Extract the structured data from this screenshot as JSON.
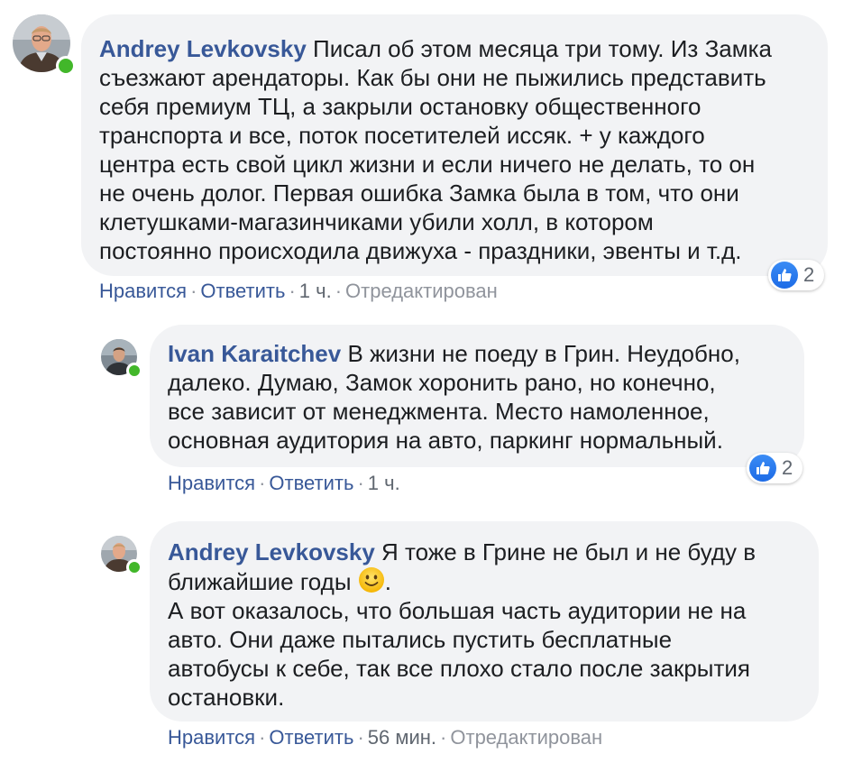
{
  "comments": [
    {
      "author": "Andrey Levkovsky",
      "lines": [
        "Писал об этом месяца три тому. Из Замка",
        "съезжают арендаторы. Как бы они не пыжились представить",
        "себя премиум ТЦ, а закрыли остановку общественного",
        "транспорта и все, поток посетителей иссяк. + у каждого",
        "центра есть свой цикл жизни и если ничего не делать, то он",
        "не очень долог. Первая ошибка Замка была в том, что они",
        "клетушками-магазинчиками убили холл, в котором",
        "постоянно происходила движуха - праздники, эвенты и т.д."
      ],
      "actions": {
        "like": "Нравится",
        "reply": "Ответить",
        "time": "1 ч.",
        "edited": "Отредактирован"
      },
      "reaction_count": "2"
    },
    {
      "author": "Ivan Karaitchev",
      "lines": [
        "В жизни не поеду в Грин. Неудобно,",
        "далеко. Думаю, Замок хоронить рано, но конечно,",
        "все зависит от менеджмента. Место намоленное,",
        "основная аудитория на авто, паркинг нормальный."
      ],
      "actions": {
        "like": "Нравится",
        "reply": "Ответить",
        "time": "1 ч."
      },
      "reaction_count": "2"
    },
    {
      "author": "Andrey Levkovsky",
      "lines": [
        "Я тоже в Грине не был и не буду в",
        "ближайшие годы",
        ".",
        "А вот оказалось, что большая часть аудитории не на",
        "авто. Они даже пытались пустить бесплатные",
        "автобусы к себе, так все плохо стало после закрытия",
        "остановки."
      ],
      "actions": {
        "like": "Нравится",
        "reply": "Ответить",
        "time": "56 мин.",
        "edited": "Отредактирован"
      }
    }
  ],
  "colors": {
    "bubble_bg": "#f2f3f5",
    "author": "#385898",
    "link": "#385898",
    "meta": "#90949c",
    "online": "#42b72a",
    "like_blue": "#1d6be6"
  },
  "icons": {
    "online_indicator": "green-dot",
    "reaction": "like-thumbs-up-icon",
    "emoji": "slightly-smiling-face-icon"
  }
}
